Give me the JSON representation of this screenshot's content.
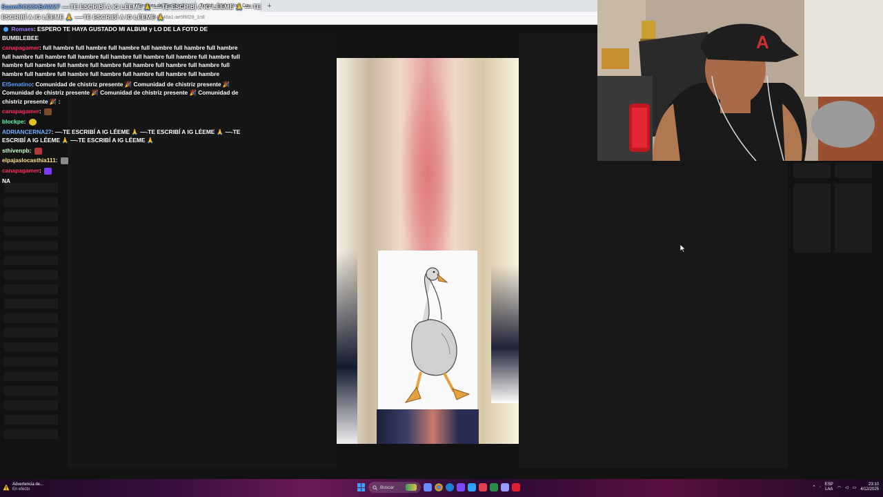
{
  "browser": {
    "tabs": [
      {
        "label": "Mensajes de Facebook",
        "active": false
      },
      {
        "label": "Twitch - Make Your Day",
        "active": true
      }
    ],
    "address_fragment": "25-9f49-46a1-ae5f6f28_1n8"
  },
  "ticker": {
    "line1_user": "SaamRO23KBAW27",
    "line1_text": "—-TE ESCRIBÍ A IG LÉEME 🙏 —-TE ESCRIBÍ A IG LÉEME 🙏 —-TE",
    "line2_text": "ESCRIBÍ A IG LÉEME 🙏 —-TE ESCRIBÍ A IG LÉEME 🙏"
  },
  "chat": {
    "messages": [
      {
        "user": "Romaes",
        "user_color": "#9b7bff",
        "text": ": ESPERO TE HAYA GUSTADO MI ALBUM y LO DE LA FOTO DE BUMBLEBEE",
        "badge": true
      },
      {
        "user": "canapagamer",
        "user_color": "#ff2e5c",
        "text": ": full hambre full hambre full hambre full hambre full hambre full hambre full hambre full hambre full hambre full hambre full hambre full hambre full hambre full hambre full hambre full hambre full hambre full hambre full hambre full hambre full hambre full hambre full hambre full hambre full hambre full hambre full hambre"
      },
      {
        "user": "ElSenatino",
        "user_color": "#5aa0ff",
        "text": ": Comunidad de chistriz presente 🎉 Comunidad de chistriz presente 🎉 Comunidad de chistriz presente 🎉 Comunidad de chistriz presente 🎉 Comunidad de chistriz presente 🎉 :"
      },
      {
        "user": "canapagamer",
        "user_color": "#ff2e5c",
        "text": ":",
        "emote": "#7a4a2a"
      },
      {
        "user": "blockpe",
        "user_color": "#5cffb0",
        "text": ":",
        "emote": "#e6c020"
      },
      {
        "user": "ADRIANCERNA27",
        "user_color": "#6ab0ff",
        "text": ": —-TE ESCRIBÍ A IG LÉEME 🙏 —-TE ESCRIBÍ A IG LÉEME 🙏 —-TE ESCRIBÍ A IG LÉEME 🙏 —-TE ESCRIBÍ A IG LÉEME 🙏"
      },
      {
        "user": "sthivenpb",
        "user_color": "#c8ffc8",
        "text": ":",
        "emote": "#b03a3a"
      },
      {
        "user": "elpajaslocasthia111",
        "user_color": "#ffe08a",
        "text": ":",
        "emote": "#8a8a8a"
      },
      {
        "user": "canapagamer",
        "user_color": "#ff2e5c",
        "text": ":",
        "emote": "#7a3aff"
      }
    ],
    "trailing": "NA"
  },
  "taskbar": {
    "warning_title": "Advertencia de...",
    "warning_sub": "En efecto",
    "search_placeholder": "Buscar",
    "lang_top": "ESP",
    "lang_bottom": "LAA",
    "time": "23:10",
    "date": "4/12/2025",
    "colors": {
      "start": "#3aa0ff"
    }
  },
  "icons": [
    "warning-icon",
    "windows-start-icon",
    "search-icon",
    "chrome-icon",
    "edge-icon",
    "twitch-icon",
    "wifi-icon",
    "volume-icon",
    "battery-icon"
  ]
}
